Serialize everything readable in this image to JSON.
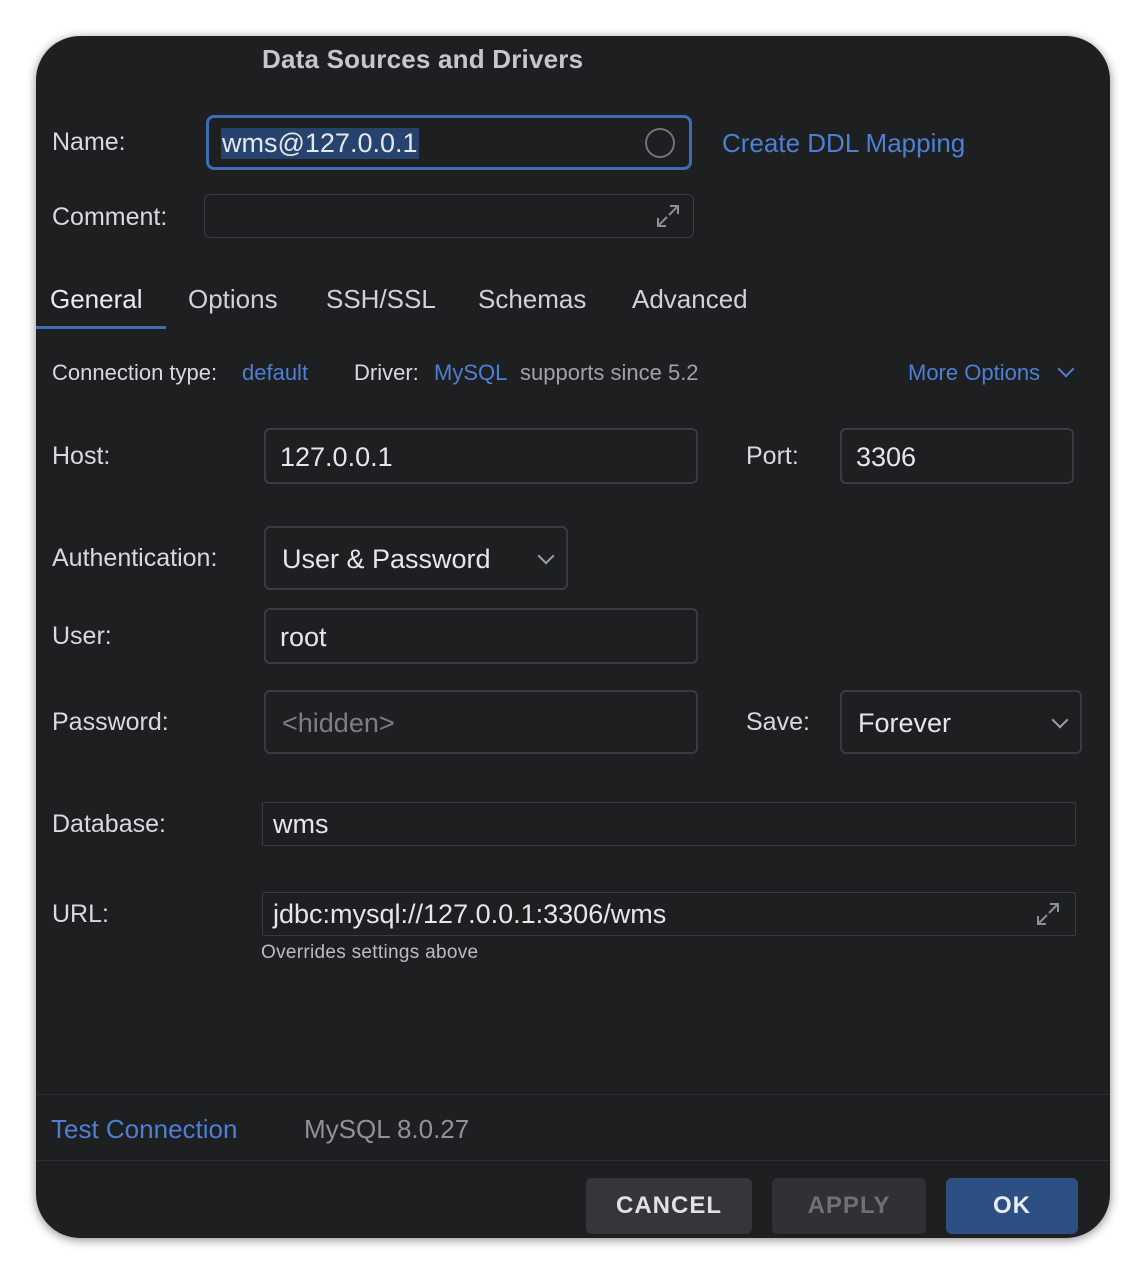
{
  "window": {
    "title": "Data Sources and Drivers"
  },
  "name": {
    "label": "Name:",
    "value": "wms@127.0.0.1",
    "link": "Create DDL Mapping"
  },
  "comment": {
    "label": "Comment:",
    "value": ""
  },
  "tabs": [
    {
      "label": "General",
      "active": true
    },
    {
      "label": "Options",
      "active": false
    },
    {
      "label": "SSH/SSL",
      "active": false
    },
    {
      "label": "Schemas",
      "active": false
    },
    {
      "label": "Advanced",
      "active": false
    }
  ],
  "connection": {
    "type_label": "Connection type:",
    "type_value": "default",
    "driver_label": "Driver:",
    "driver_value": "MySQL",
    "driver_note": "supports since 5.2",
    "more_options": "More Options"
  },
  "host": {
    "label": "Host:",
    "value": "127.0.0.1"
  },
  "port": {
    "label": "Port:",
    "value": "3306"
  },
  "authentication": {
    "label": "Authentication:",
    "value": "User & Password"
  },
  "user": {
    "label": "User:",
    "value": "root"
  },
  "password": {
    "label": "Password:",
    "placeholder": "<hidden>"
  },
  "save": {
    "label": "Save:",
    "value": "Forever"
  },
  "database": {
    "label": "Database:",
    "value": "wms"
  },
  "url": {
    "label": "URL:",
    "value": "jdbc:mysql://127.0.0.1:3306/wms",
    "hint": "Overrides settings above"
  },
  "footer": {
    "test_connection": "Test Connection",
    "server_version": "MySQL 8.0.27"
  },
  "buttons": {
    "cancel": "CANCEL",
    "apply": "APPLY",
    "ok": "OK"
  },
  "colors": {
    "background": "#1e1f21",
    "link": "#4d7fd4",
    "focus_border": "#3e6db5",
    "ok_button": "#2e4f82"
  }
}
